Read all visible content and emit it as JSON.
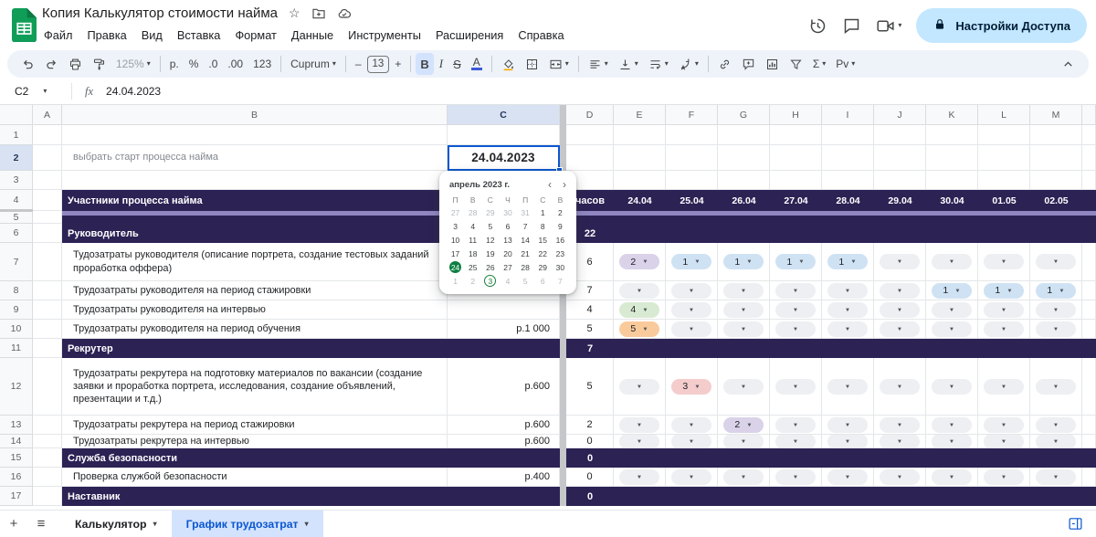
{
  "header": {
    "title": "Копия Калькулятор стоимости найма",
    "menus": [
      "Файл",
      "Правка",
      "Вид",
      "Вставка",
      "Формат",
      "Данные",
      "Инструменты",
      "Расширения",
      "Справка"
    ],
    "share_label": "Настройки Доступа"
  },
  "icons": {
    "caret": "▾",
    "star": "☆",
    "plus": "+",
    "hamburger": "≡",
    "prev": "‹",
    "next": "›",
    "dropdown_triangle": "▼"
  },
  "colors": {
    "accent": "#0b57d0",
    "share_button_bg": "#c2e7ff",
    "section_purple": "#2c2254",
    "active_tab_bg": "#d3e3fd",
    "calendar_selected_green": "#0b8043"
  },
  "toolbar": {
    "items": [
      {
        "name": "undo",
        "icon": "undo"
      },
      {
        "name": "redo",
        "icon": "redo"
      },
      {
        "name": "print",
        "icon": "print"
      },
      {
        "name": "paint-format",
        "icon": "paint"
      },
      {
        "name": "zoom",
        "text": "125%",
        "caret": true,
        "dim": true
      },
      {
        "sep": true
      },
      {
        "name": "currency-format",
        "text": "р."
      },
      {
        "name": "percent-format",
        "text": "%"
      },
      {
        "name": "decrease-decimal",
        "text": ".0"
      },
      {
        "name": "increase-decimal",
        "text": ".00"
      },
      {
        "name": "number-format",
        "text": "123"
      },
      {
        "sep": true
      },
      {
        "name": "font-family",
        "text": "Cuprum",
        "caret": true
      },
      {
        "sep": true
      },
      {
        "name": "decrease-font-size",
        "text": "–"
      },
      {
        "name": "font-size",
        "text": "13",
        "box": true
      },
      {
        "name": "increase-font-size",
        "text": "+"
      },
      {
        "sep": true
      },
      {
        "name": "bold",
        "text": "B",
        "style": "bold",
        "active": true
      },
      {
        "name": "italic",
        "text": "I",
        "style": "italic"
      },
      {
        "name": "strikethrough",
        "text": "S",
        "style": "strike"
      },
      {
        "name": "text-color",
        "text": "A",
        "style": "textcolor"
      },
      {
        "sep": true
      },
      {
        "name": "fill-color",
        "icon": "fill"
      },
      {
        "name": "borders",
        "icon": "borders"
      },
      {
        "name": "merge-cells",
        "icon": "merge",
        "caret": true
      },
      {
        "sep": true
      },
      {
        "name": "horizontal-align",
        "icon": "align",
        "caret": true
      },
      {
        "name": "vertical-align",
        "icon": "valign",
        "caret": true
      },
      {
        "name": "text-wrap",
        "icon": "wrap",
        "caret": true
      },
      {
        "name": "text-rotation",
        "icon": "rotate",
        "caret": true
      },
      {
        "sep": true
      },
      {
        "name": "insert-link",
        "icon": "link"
      },
      {
        "name": "insert-comment",
        "icon": "comment"
      },
      {
        "name": "insert-chart",
        "icon": "chart"
      },
      {
        "name": "create-filter",
        "icon": "filter"
      },
      {
        "name": "functions",
        "text": "Σ",
        "caret": true
      },
      {
        "name": "pv",
        "text": "Pv",
        "caret": true
      }
    ]
  },
  "formula_bar": {
    "cell_ref": "C2",
    "fx": "fx",
    "value": "24.04.2023"
  },
  "sheet": {
    "columns": [
      "A",
      "B",
      "C",
      "D",
      "E",
      "F",
      "G",
      "H",
      "I",
      "J",
      "K",
      "L",
      "M"
    ],
    "pill_colors": {
      "purple": "#d9d2e9",
      "blue": "#cfe2f3",
      "green": "#d9ead3",
      "orange": "#f9cb9c",
      "red": "#f4cccc",
      "empty": "#edeff2"
    },
    "rows": [
      {
        "n": 1
      },
      {
        "n": 2,
        "b": "выбрать старт процесса найма",
        "c": "24.04.2023",
        "selected": true
      },
      {
        "n": 3
      },
      {
        "n": 4,
        "type": "section",
        "b": "Участники процесса найма",
        "d": "часов",
        "dates": [
          "24.04",
          "25.04",
          "26.04",
          "27.04",
          "28.04",
          "29.04",
          "30.04",
          "01.05",
          "02.05"
        ]
      },
      {
        "n": 5,
        "type": "spacer"
      },
      {
        "n": 6,
        "type": "section",
        "b": "Руководитель",
        "d": "22"
      },
      {
        "n": 7,
        "b": "Тудозатраты руководителя (описание портрета, создание тестовых заданий проработка оффера)",
        "d": "6",
        "pills": [
          [
            "2",
            "purple"
          ],
          [
            "1",
            "blue"
          ],
          [
            "1",
            "blue"
          ],
          [
            "1",
            "blue"
          ],
          [
            "1",
            "blue"
          ],
          [],
          [],
          [],
          []
        ]
      },
      {
        "n": 8,
        "b": "Трудозатраты руководителя на период стажировки",
        "d": "7",
        "pills": [
          [],
          [],
          [],
          [],
          [],
          [],
          [
            "1",
            "blue"
          ],
          [
            "1",
            "blue"
          ],
          [
            "1",
            "blue"
          ]
        ]
      },
      {
        "n": 9,
        "b": "Трудозатраты руководителя на интервью",
        "d": "4",
        "pills": [
          [
            "4",
            "green"
          ],
          [],
          [],
          [],
          [],
          [],
          [],
          [],
          []
        ]
      },
      {
        "n": 10,
        "b": "Трудозатраты руководителя на период обучения",
        "c": "р.1 000",
        "d": "5",
        "pills": [
          [
            "5",
            "orange"
          ],
          [],
          [],
          [],
          [],
          [],
          [],
          [],
          []
        ]
      },
      {
        "n": 11,
        "type": "section",
        "b": "Рекрутер",
        "d": "7"
      },
      {
        "n": 12,
        "b": "Трудозатраты рекрутера на подготовку материалов по вакансии (создание заявки и проработка портрета, исследования, создание объявлений, презентации и т.д.)",
        "c": "р.600",
        "d": "5",
        "pills": [
          [],
          [
            "3",
            "red"
          ],
          [],
          [],
          [],
          [],
          [],
          [],
          []
        ]
      },
      {
        "n": 13,
        "b": "Трудозатраты рекрутера на период стажировки",
        "c": "р.600",
        "d": "2",
        "pills": [
          [],
          [],
          [
            "2",
            "purple"
          ],
          [],
          [],
          [],
          [],
          [],
          []
        ]
      },
      {
        "n": 14,
        "b": "Трудозатраты рекрутера на интервью",
        "c": "р.600",
        "d": "0",
        "pills": [
          [],
          [],
          [],
          [],
          [],
          [],
          [],
          [],
          []
        ]
      },
      {
        "n": 15,
        "type": "section",
        "b": "Служба безопасности",
        "d": "0"
      },
      {
        "n": 16,
        "b": "Проверка службой безопасности",
        "c": "р.400",
        "d": "0",
        "pills": [
          [],
          [],
          [],
          [],
          [],
          [],
          [],
          [],
          []
        ]
      },
      {
        "n": 17,
        "type": "section",
        "b": "Наставник",
        "d": "0"
      }
    ]
  },
  "calendar": {
    "title": "апрель 2023 г.",
    "weekdays": [
      "П",
      "В",
      "С",
      "Ч",
      "П",
      "С",
      "В"
    ],
    "weeks": [
      [
        {
          "d": 27,
          "out": true
        },
        {
          "d": 28,
          "out": true
        },
        {
          "d": 29,
          "out": true
        },
        {
          "d": 30,
          "out": true
        },
        {
          "d": 31,
          "out": true
        },
        {
          "d": 1
        },
        {
          "d": 2
        }
      ],
      [
        {
          "d": 3
        },
        {
          "d": 4
        },
        {
          "d": 5
        },
        {
          "d": 6
        },
        {
          "d": 7
        },
        {
          "d": 8
        },
        {
          "d": 9
        }
      ],
      [
        {
          "d": 10
        },
        {
          "d": 11
        },
        {
          "d": 12
        },
        {
          "d": 13
        },
        {
          "d": 14
        },
        {
          "d": 15
        },
        {
          "d": 16
        }
      ],
      [
        {
          "d": 17
        },
        {
          "d": 18
        },
        {
          "d": 19
        },
        {
          "d": 20
        },
        {
          "d": 21
        },
        {
          "d": 22
        },
        {
          "d": 23
        }
      ],
      [
        {
          "d": 24,
          "selected": true
        },
        {
          "d": 25
        },
        {
          "d": 26
        },
        {
          "d": 27
        },
        {
          "d": 28
        },
        {
          "d": 29
        },
        {
          "d": 30
        }
      ],
      [
        {
          "d": 1,
          "out": true
        },
        {
          "d": 2,
          "out": true
        },
        {
          "d": 3,
          "out": true,
          "today": true
        },
        {
          "d": 4,
          "out": true
        },
        {
          "d": 5,
          "out": true
        },
        {
          "d": 6,
          "out": true
        },
        {
          "d": 7,
          "out": true
        }
      ]
    ]
  },
  "footer": {
    "tabs": [
      {
        "label": "Калькулятор"
      },
      {
        "label": "График трудозатрат",
        "active": true
      }
    ]
  }
}
